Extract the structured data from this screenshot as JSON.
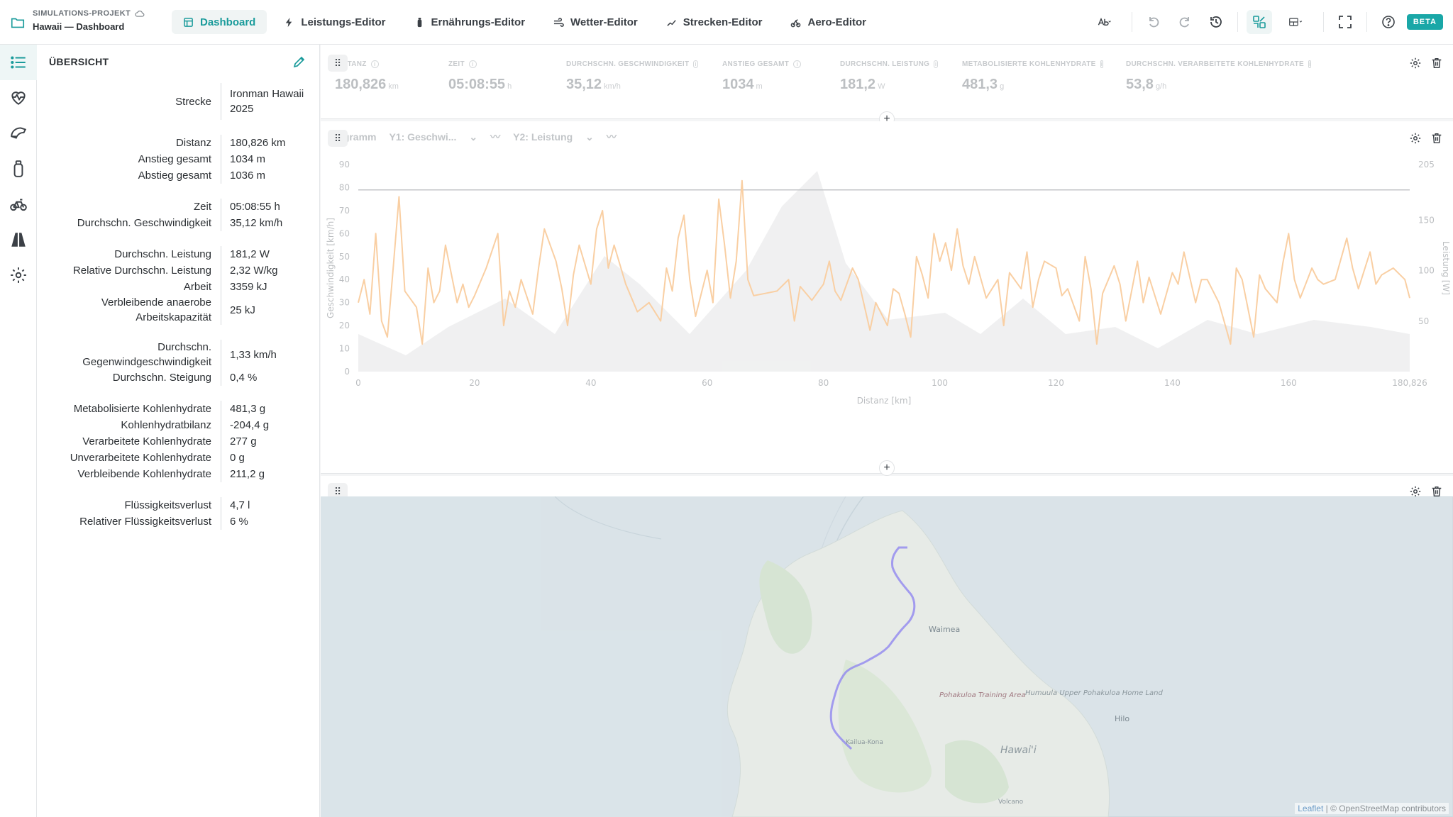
{
  "project": {
    "kicker": "SIMULATIONS-PROJEKT",
    "title": "Hawaii — Dashboard"
  },
  "tabs": [
    {
      "label": "Dashboard",
      "icon": "dashboard-icon",
      "active": true
    },
    {
      "label": "Leistungs-Editor",
      "icon": "bolt-icon"
    },
    {
      "label": "Ernährungs-Editor",
      "icon": "bottle-icon"
    },
    {
      "label": "Wetter-Editor",
      "icon": "wind-icon"
    },
    {
      "label": "Strecken-Editor",
      "icon": "route-icon"
    },
    {
      "label": "Aero-Editor",
      "icon": "aero-icon"
    }
  ],
  "toolbar": {
    "beta_label": "BETA",
    "colors": {
      "accent": "#1aa7a7",
      "accent_text": "#1a9b9b"
    }
  },
  "rail": [
    {
      "icon": "list-icon",
      "active": true
    },
    {
      "icon": "heart-rate-icon"
    },
    {
      "icon": "helmet-icon"
    },
    {
      "icon": "bottle-icon"
    },
    {
      "icon": "bike-icon"
    },
    {
      "icon": "road-icon"
    },
    {
      "icon": "gear-icon"
    }
  ],
  "overview": {
    "heading": "ÜBERSICHT",
    "groups": [
      [
        {
          "label": "Strecke",
          "value": "Ironman Hawaii 2025"
        }
      ],
      [
        {
          "label": "Distanz",
          "value": "180,826 km"
        },
        {
          "label": "Anstieg gesamt",
          "value": "1034 m"
        },
        {
          "label": "Abstieg gesamt",
          "value": "1036 m"
        }
      ],
      [
        {
          "label": "Zeit",
          "value": "05:08:55 h"
        },
        {
          "label": "Durchschn. Geschwindigkeit",
          "value": "35,12 km/h"
        }
      ],
      [
        {
          "label": "Durchschn. Leistung",
          "value": "181,2 W"
        },
        {
          "label": "Relative Durchschn. Leistung",
          "value": "2,32 W/kg"
        },
        {
          "label": "Arbeit",
          "value": "3359 kJ"
        },
        {
          "label": "Verbleibende anaerobe Arbeitskapazität",
          "value": "25 kJ"
        }
      ],
      [
        {
          "label": "Durchschn. Gegenwindgeschwindigkeit",
          "value": "1,33 km/h"
        },
        {
          "label": "Durchschn. Steigung",
          "value": "0,4 %"
        }
      ],
      [
        {
          "label": "Metabolisierte Kohlenhydrate",
          "value": "481,3 g"
        },
        {
          "label": "Kohlenhydratbilanz",
          "value": "-204,4 g"
        },
        {
          "label": "Verarbeitete Kohlenhydrate",
          "value": "277 g"
        },
        {
          "label": "Unverarbeitete Kohlenhydrate",
          "value": "0 g"
        },
        {
          "label": "Verbleibende Kohlenhydrate",
          "value": "211,2 g"
        }
      ],
      [
        {
          "label": "Flüssigkeitsverlust",
          "value": "4,7 l"
        },
        {
          "label": "Relativer Flüssigkeitsverlust",
          "value": "6 %"
        }
      ]
    ]
  },
  "kpis": [
    {
      "label": "DISTANZ",
      "value": "180,826",
      "unit": "km"
    },
    {
      "label": "ZEIT",
      "value": "05:08:55",
      "unit": "h"
    },
    {
      "label": "DURCHSCHN. GESCHWINDIGKEIT",
      "value": "35,12",
      "unit": "km/h"
    },
    {
      "label": "ANSTIEG GESAMT",
      "value": "1034",
      "unit": "m"
    },
    {
      "label": "DURCHSCHN. LEISTUNG",
      "value": "181,2",
      "unit": "W"
    },
    {
      "label": "METABOLISIERTE KOHLENHYDRATE",
      "value": "481,3",
      "unit": "g"
    },
    {
      "label": "DURCHSCHN. VERARBEITETE KOHLENHYDRATE",
      "value": "53,8",
      "unit": "g/h"
    }
  ],
  "chart_controls": {
    "title": "Diagramm",
    "y1": "Y1: Geschwi...",
    "y2": "Y2: Leistung"
  },
  "chart_data": {
    "type": "line",
    "xlabel": "Distanz [km]",
    "ylabel": "Geschwindigkeit [km/h]",
    "y2label": "Leistung [W]",
    "xlim": [
      0,
      180.826
    ],
    "ylim": [
      0,
      90
    ],
    "y2lim": [
      0,
      205
    ],
    "x_ticks": [
      "0",
      "20",
      "40",
      "60",
      "80",
      "100",
      "120",
      "140",
      "160",
      "180,826"
    ],
    "y_ticks": [
      "0",
      "10",
      "20",
      "30",
      "40",
      "50",
      "60",
      "70",
      "80",
      "90"
    ],
    "y2_ticks": [
      "50",
      "100",
      "150",
      "205"
    ],
    "reference_line_y": 79,
    "series": [
      {
        "color": "#f5a04a",
        "x": [
          0,
          1,
          2,
          3,
          4,
          5,
          6,
          7,
          8,
          10,
          11,
          12,
          13,
          14,
          15,
          17,
          18,
          19,
          20,
          22,
          24,
          25,
          26,
          27,
          28,
          30,
          31,
          32,
          34,
          35,
          36,
          37,
          38,
          40,
          41,
          42,
          43,
          44,
          46,
          48,
          50,
          52,
          53,
          54,
          55,
          56,
          57,
          58,
          59,
          60,
          61,
          62,
          63,
          64,
          65,
          66,
          67,
          68,
          70,
          72,
          74,
          75,
          76,
          78,
          80,
          81,
          82,
          83,
          85,
          86,
          88,
          89,
          90,
          91,
          92,
          93,
          94,
          95,
          96,
          97,
          98,
          99,
          100,
          101,
          102,
          103,
          104,
          105,
          106,
          108,
          110,
          111,
          112,
          114,
          115,
          116,
          117,
          118,
          120,
          121,
          122,
          124,
          125,
          126,
          127,
          128,
          130,
          131,
          132,
          134,
          135,
          136,
          138,
          140,
          141,
          142,
          144,
          145,
          146,
          148,
          150,
          151,
          152,
          154,
          155,
          156,
          158,
          159,
          160,
          161,
          162,
          164,
          165,
          166,
          168,
          170,
          171,
          172,
          174,
          175,
          176,
          178,
          180,
          180.826
        ],
        "values": [
          30,
          40,
          25,
          60,
          22,
          15,
          45,
          76,
          35,
          28,
          12,
          45,
          30,
          35,
          55,
          30,
          38,
          28,
          33,
          45,
          60,
          20,
          35,
          28,
          40,
          25,
          45,
          62,
          48,
          36,
          20,
          42,
          55,
          38,
          62,
          70,
          45,
          55,
          38,
          26,
          30,
          22,
          45,
          35,
          58,
          68,
          40,
          24,
          34,
          44,
          30,
          75,
          55,
          32,
          48,
          83,
          40,
          33,
          34,
          35,
          40,
          22,
          37,
          31,
          38,
          48,
          35,
          31,
          45,
          40,
          18,
          30,
          25,
          20,
          36,
          34,
          25,
          15,
          50,
          42,
          32,
          60,
          48,
          56,
          44,
          62,
          46,
          38,
          50,
          32,
          40,
          20,
          43,
          36,
          52,
          28,
          40,
          48,
          45,
          33,
          36,
          22,
          50,
          36,
          12,
          34,
          46,
          38,
          22,
          48,
          30,
          41,
          25,
          43,
          38,
          52,
          30,
          40,
          40,
          30,
          12,
          45,
          40,
          15,
          42,
          36,
          30,
          47,
          60,
          40,
          32,
          45,
          40,
          38,
          40,
          58,
          45,
          36,
          52,
          38,
          42,
          45,
          40,
          32
        ]
      }
    ]
  },
  "map": {
    "labels": [
      "Waimea",
      "Pohakuloa Training Area",
      "Humuula Upper Pohakuloa Home Land",
      "Hilo",
      "Hawai'i",
      "Kailua-Kona",
      "Volcano"
    ],
    "attribution_link": "Leaflet",
    "attribution_text": "| © OpenStreetMap contributors"
  }
}
